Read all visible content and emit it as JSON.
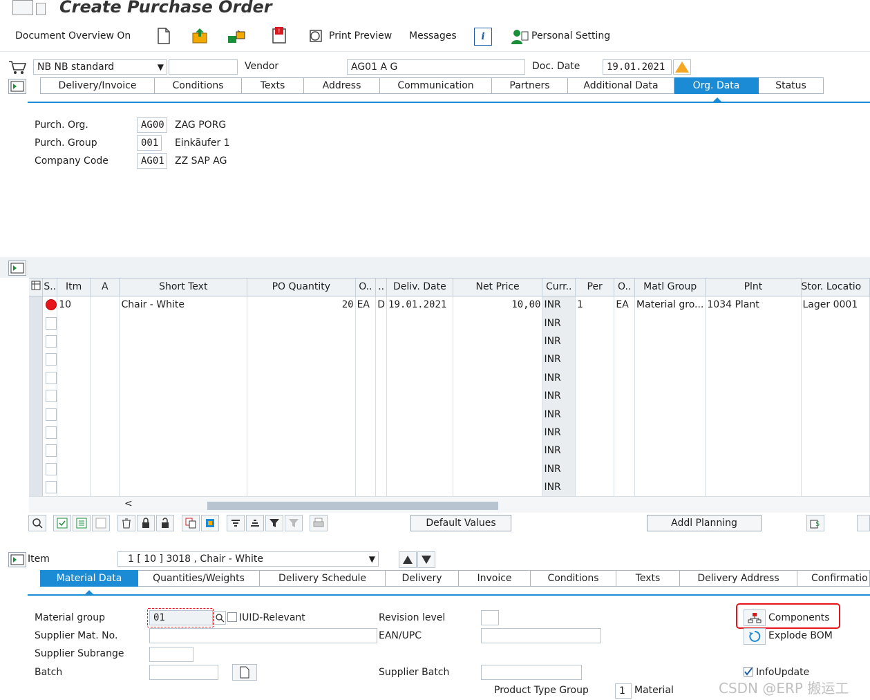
{
  "window": {
    "title": "Create Purchase Order"
  },
  "toolbar": {
    "document_overview": "Document Overview On",
    "print_preview": "Print Preview",
    "messages": "Messages",
    "personal_setting": "Personal Setting"
  },
  "header": {
    "doc_type": "NB NB standard",
    "vendor_label": "Vendor",
    "vendor_value": "AG01 A G",
    "doc_date_label": "Doc. Date",
    "doc_date_value": "19.01.2021",
    "tabs": [
      "Delivery/Invoice",
      "Conditions",
      "Texts",
      "Address",
      "Communication",
      "Partners",
      "Additional Data",
      "Org. Data",
      "Status"
    ],
    "active_tab": "Org. Data"
  },
  "org_data": {
    "purch_org": {
      "label": "Purch. Org.",
      "code": "AG00",
      "text": "ZAG PORG"
    },
    "purch_group": {
      "label": "Purch. Group",
      "code": "001",
      "text": "Einkäufer 1"
    },
    "company_code": {
      "label": "Company Code",
      "code": "AG01",
      "text": "ZZ SAP AG"
    }
  },
  "items_table": {
    "columns": [
      "S..",
      "Itm",
      "A",
      "Short Text",
      "PO Quantity",
      "O..",
      "..",
      "Deliv. Date",
      "Net Price",
      "Curr..",
      "Per",
      "O..",
      "Matl Group",
      "Plnt",
      "Stor. Locatio"
    ],
    "rows": [
      {
        "itm": "10",
        "a": "",
        "short_text": "Chair - White",
        "po_qty": "20",
        "ou": "EA",
        "d": "D",
        "deliv_date": "19.01.2021",
        "net_price": "10,00",
        "curr": "INR",
        "per": "1",
        "opu": "EA",
        "matl_group": "Material gro...",
        "plnt": "1034 Plant",
        "stor_loc": "Lager 0001"
      },
      {
        "curr": "INR"
      },
      {
        "curr": "INR"
      },
      {
        "curr": "INR"
      },
      {
        "curr": "INR"
      },
      {
        "curr": "INR"
      },
      {
        "curr": "INR"
      },
      {
        "curr": "INR"
      },
      {
        "curr": "INR"
      },
      {
        "curr": "INR"
      },
      {
        "curr": "INR"
      }
    ]
  },
  "table_buttons": {
    "default_values": "Default Values",
    "addl_planning": "Addl Planning"
  },
  "item_detail": {
    "item_label": "Item",
    "item_select": "1 [ 10 ] 3018 , Chair - White",
    "tabs": [
      "Material Data",
      "Quantities/Weights",
      "Delivery Schedule",
      "Delivery",
      "Invoice",
      "Conditions",
      "Texts",
      "Delivery Address",
      "Confirmatio"
    ],
    "active_tab": "Material Data",
    "material_group_label": "Material group",
    "material_group_value": "01",
    "iuid_label": "IUID-Relevant",
    "revision_label": "Revision level",
    "supplier_mat_label": "Supplier Mat. No.",
    "ean_label": "EAN/UPC",
    "supplier_subrange_label": "Supplier Subrange",
    "batch_label": "Batch",
    "supplier_batch_label": "Supplier Batch",
    "product_type_label": "Product Type Group",
    "product_type_code": "1",
    "product_type_text": "Material",
    "components_btn": "Components",
    "explode_bom_btn": "Explode BOM",
    "infoupdate_label": "InfoUpdate",
    "infoupdate_checked": true
  },
  "watermark": "CSDN @ERP 搬运工",
  "colors": {
    "accent": "#1c8bd6",
    "highlight": "#e5151b",
    "warning": "#f5a623"
  }
}
